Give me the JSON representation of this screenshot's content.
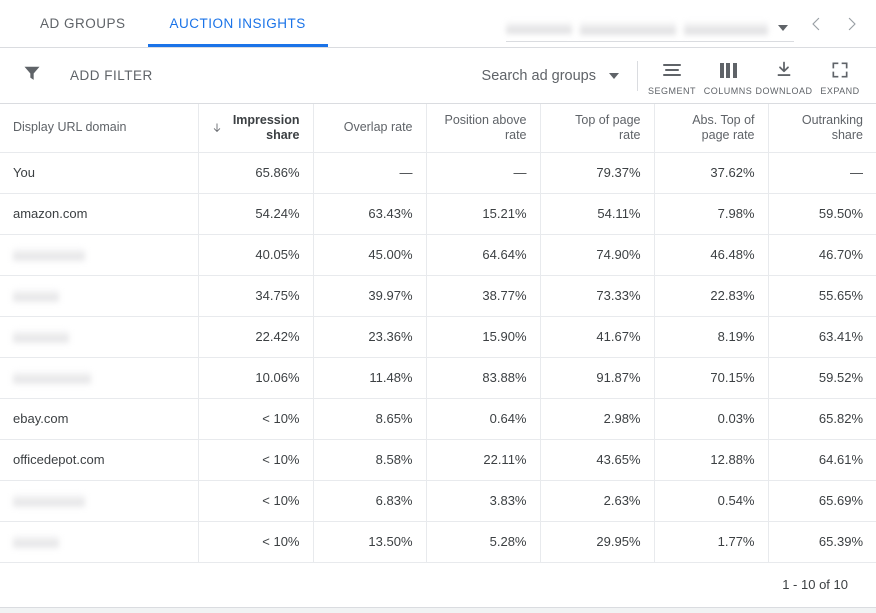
{
  "tabs": [
    {
      "label": "AD GROUPS",
      "active": false
    },
    {
      "label": "AUCTION INSIGHTS",
      "active": true
    }
  ],
  "account_picker": {
    "redacted": true,
    "dropdown_icon": "chevron-down-icon",
    "prev_icon": "chevron-left-icon",
    "next_icon": "chevron-right-icon"
  },
  "toolbar": {
    "filter_icon": "funnel-icon",
    "add_filter_label": "ADD FILTER",
    "search_label": "Search ad groups",
    "search_caret_icon": "chevron-down-icon",
    "actions": [
      {
        "label": "SEGMENT",
        "icon": "segment-icon"
      },
      {
        "label": "COLUMNS",
        "icon": "columns-icon"
      },
      {
        "label": "DOWNLOAD",
        "icon": "download-icon"
      },
      {
        "label": "EXPAND",
        "icon": "expand-icon"
      }
    ]
  },
  "table": {
    "sort": {
      "column": "Impression share",
      "direction": "desc",
      "icon": "arrow-down-icon"
    },
    "columns": [
      {
        "label": "Display URL domain",
        "align": "left",
        "sorted": false
      },
      {
        "label": "Impression share",
        "align": "right",
        "sorted": true
      },
      {
        "label": "Overlap rate",
        "align": "right",
        "sorted": false
      },
      {
        "label": "Position above rate",
        "align": "right",
        "sorted": false
      },
      {
        "label": "Top of page rate",
        "align": "right",
        "sorted": false
      },
      {
        "label": "Abs. Top of page rate",
        "align": "right",
        "sorted": false
      },
      {
        "label": "Outranking share",
        "align": "right",
        "sorted": false
      }
    ],
    "rows": [
      {
        "domain": "You",
        "redacted": false,
        "impression_share": "65.86%",
        "overlap_rate": "—",
        "position_above_rate": "—",
        "top_of_page_rate": "79.37%",
        "abs_top_of_page_rate": "37.62%",
        "outranking_share": "—"
      },
      {
        "domain": "amazon.com",
        "redacted": false,
        "impression_share": "54.24%",
        "overlap_rate": "63.43%",
        "position_above_rate": "15.21%",
        "top_of_page_rate": "54.11%",
        "abs_top_of_page_rate": "7.98%",
        "outranking_share": "59.50%"
      },
      {
        "domain": "",
        "redacted": true,
        "impression_share": "40.05%",
        "overlap_rate": "45.00%",
        "position_above_rate": "64.64%",
        "top_of_page_rate": "74.90%",
        "abs_top_of_page_rate": "46.48%",
        "outranking_share": "46.70%"
      },
      {
        "domain": "",
        "redacted": true,
        "impression_share": "34.75%",
        "overlap_rate": "39.97%",
        "position_above_rate": "38.77%",
        "top_of_page_rate": "73.33%",
        "abs_top_of_page_rate": "22.83%",
        "outranking_share": "55.65%"
      },
      {
        "domain": "",
        "redacted": true,
        "impression_share": "22.42%",
        "overlap_rate": "23.36%",
        "position_above_rate": "15.90%",
        "top_of_page_rate": "41.67%",
        "abs_top_of_page_rate": "8.19%",
        "outranking_share": "63.41%"
      },
      {
        "domain": "",
        "redacted": true,
        "impression_share": "10.06%",
        "overlap_rate": "11.48%",
        "position_above_rate": "83.88%",
        "top_of_page_rate": "91.87%",
        "abs_top_of_page_rate": "70.15%",
        "outranking_share": "59.52%"
      },
      {
        "domain": "ebay.com",
        "redacted": false,
        "impression_share": "< 10%",
        "overlap_rate": "8.65%",
        "position_above_rate": "0.64%",
        "top_of_page_rate": "2.98%",
        "abs_top_of_page_rate": "0.03%",
        "outranking_share": "65.82%"
      },
      {
        "domain": "officedepot.com",
        "redacted": false,
        "impression_share": "< 10%",
        "overlap_rate": "8.58%",
        "position_above_rate": "22.11%",
        "top_of_page_rate": "43.65%",
        "abs_top_of_page_rate": "12.88%",
        "outranking_share": "64.61%"
      },
      {
        "domain": "",
        "redacted": true,
        "impression_share": "< 10%",
        "overlap_rate": "6.83%",
        "position_above_rate": "3.83%",
        "top_of_page_rate": "2.63%",
        "abs_top_of_page_rate": "0.54%",
        "outranking_share": "65.69%"
      },
      {
        "domain": "",
        "redacted": true,
        "impression_share": "< 10%",
        "overlap_rate": "13.50%",
        "position_above_rate": "5.28%",
        "top_of_page_rate": "29.95%",
        "abs_top_of_page_rate": "1.77%",
        "outranking_share": "65.39%"
      }
    ]
  },
  "footer": {
    "pagination": "1 - 10 of 10"
  },
  "colors": {
    "accent": "#1a73e8",
    "text_primary": "#3c4043",
    "text_secondary": "#5f6368",
    "border": "#e8eaed",
    "header_rule": "#9aa0a6",
    "page_bg": "#f1f3f4"
  }
}
